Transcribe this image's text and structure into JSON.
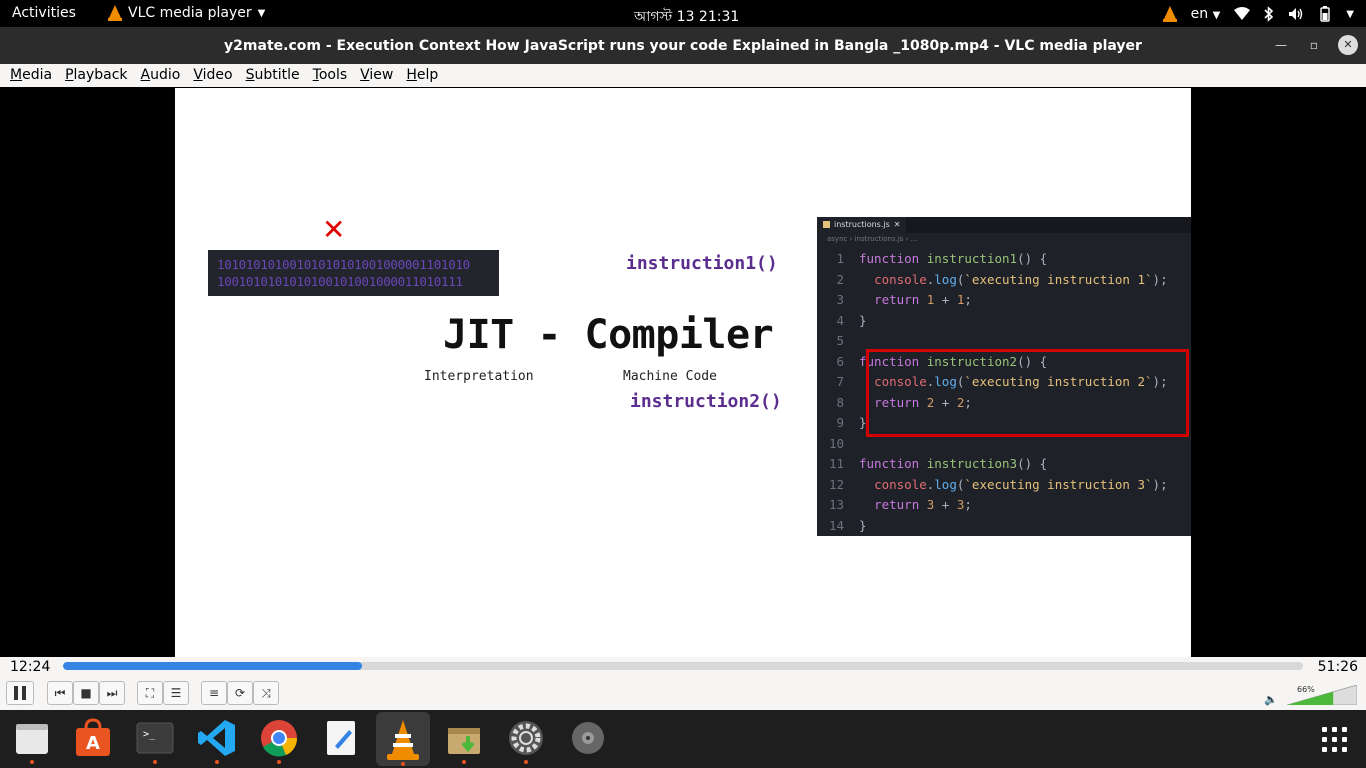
{
  "topbar": {
    "activities": "Activities",
    "app_name": "VLC media player",
    "clock": "আগস্ট 13  21:31",
    "lang": "en"
  },
  "window": {
    "title": "y2mate.com - Execution Context  How JavaScript runs your code  Explained in Bangla _1080p.mp4 - VLC media player"
  },
  "menu": [
    "Media",
    "Playback",
    "Audio",
    "Video",
    "Subtitle",
    "Tools",
    "View",
    "Help"
  ],
  "slide": {
    "binary_line1": "10101010100101010101001000001101010",
    "binary_line2": "1001010101010100101001000011010111",
    "instr1": "instruction1()",
    "instr2": "instruction2()",
    "heading": "JIT - Compiler",
    "label_interp": "Interpretation",
    "label_machine": "Machine Code",
    "x_mark": "✕"
  },
  "editor": {
    "tab": "instructions.js",
    "breadcrumb": "async  ›  instructions.js  › ...",
    "lines": [
      "1",
      "2",
      "3",
      "4",
      "5",
      "6",
      "7",
      "8",
      "9",
      "10",
      "11",
      "12",
      "13",
      "14"
    ]
  },
  "player": {
    "elapsed": "12:24",
    "total": "51:26",
    "progress": 0.241,
    "volume": "66%"
  },
  "colors": {
    "accent": "#3584e4",
    "vlc_orange": "#f08c00",
    "highlight_red": "#d40000"
  }
}
